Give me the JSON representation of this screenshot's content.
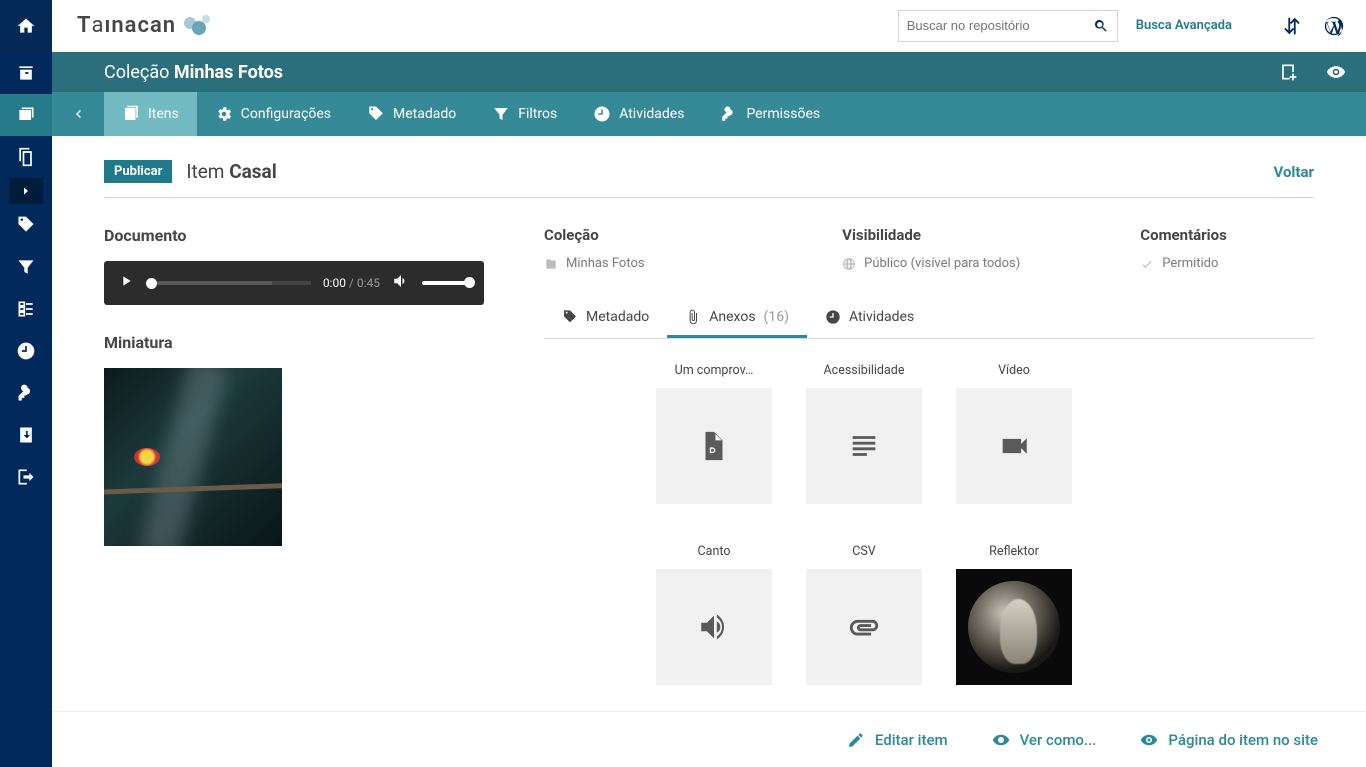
{
  "search": {
    "placeholder": "Buscar no repositório"
  },
  "advanced_search": "Busca Avançada",
  "collection": {
    "prefix": "Coleção ",
    "name": "Minhas Fotos"
  },
  "tabs": {
    "itens": "Itens",
    "config": "Configurações",
    "metadado": "Metadado",
    "filtros": "Filtros",
    "atividades": "Atividades",
    "permissoes": "Permissões"
  },
  "badge": "Publicar",
  "item": {
    "prefix": "Item ",
    "name": "Casal"
  },
  "back_link": "Voltar",
  "left": {
    "documento": "Documento",
    "miniatura": "Miniatura",
    "audio": {
      "current": "0:00",
      "total": " / 0:45"
    }
  },
  "meta": {
    "colecao_h": "Coleção",
    "colecao_v": "Minhas Fotos",
    "visibilidade_h": "Visibilidade",
    "visibilidade_v": "Público (visível para todos)",
    "comentarios_h": "Comentários",
    "comentarios_v": "Permitido"
  },
  "subtabs": {
    "metadado": "Metadado",
    "anexos": "Anexos ",
    "anexos_count": "(16)",
    "atividades": "Atividades"
  },
  "attachments": [
    {
      "name": "Um comprov…",
      "icon": "pdf"
    },
    {
      "name": "Acessibilidade",
      "icon": "text"
    },
    {
      "name": "Vídeo",
      "icon": "video"
    },
    {
      "name": "Canto",
      "icon": "audio"
    },
    {
      "name": "CSV",
      "icon": "clip"
    },
    {
      "name": "Reflektor",
      "icon": "image"
    }
  ],
  "footer": {
    "editar": "Editar item",
    "vercomo": "Ver como...",
    "pagina": "Página do item no site"
  },
  "colors": {
    "teal": "#2b8a9a",
    "darknav": "#01295c"
  }
}
